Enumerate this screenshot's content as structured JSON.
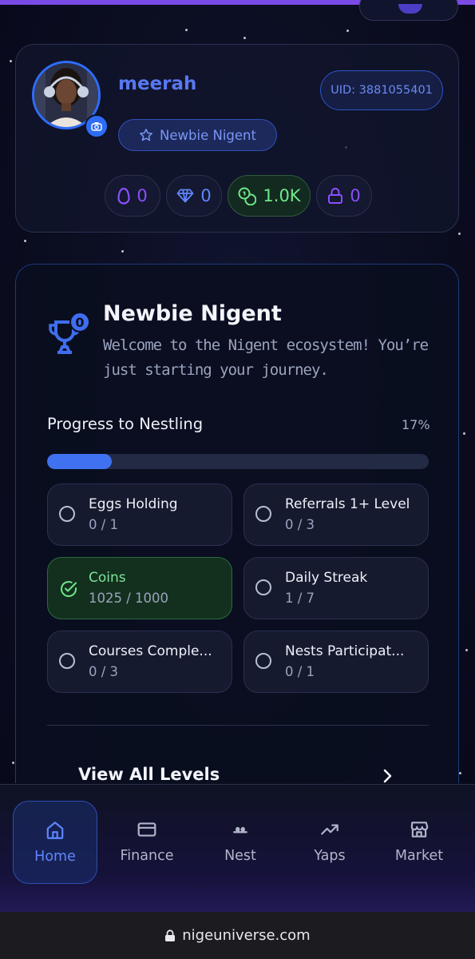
{
  "profile": {
    "username": "meerah",
    "uid": "UID: 3881055401",
    "badge": "Newbie Nigent",
    "stats": [
      {
        "icon": "egg-icon",
        "value": "0",
        "color": "#8a4fff"
      },
      {
        "icon": "diamond-icon",
        "value": "0",
        "color": "#5f86ff"
      },
      {
        "icon": "coins-icon",
        "value": "1.0K",
        "color": "#6fe88a"
      },
      {
        "icon": "lock-icon",
        "value": "0",
        "color": "#8a4fff"
      }
    ]
  },
  "level": {
    "trophy_badge": "0",
    "title": "Newbie Nigent",
    "description": "Welcome to the Nigent ecosystem! You’re just starting your journey.",
    "progress_label": "Progress to Nestling",
    "progress_percent": "17%",
    "progress_value": 0.17,
    "requirements": [
      {
        "name": "Eggs Holding",
        "value": "0 / 1",
        "done": false
      },
      {
        "name": "Referrals 1+ Level",
        "value": "0 / 3",
        "done": false
      },
      {
        "name": "Coins",
        "value": "1025 / 1000",
        "done": true
      },
      {
        "name": "Daily Streak",
        "value": "1 / 7",
        "done": false
      },
      {
        "name": "Courses Comple...",
        "value": "0 / 3",
        "done": false
      },
      {
        "name": "Nests Participat...",
        "value": "0 / 1",
        "done": false
      }
    ],
    "view_all": "View All Levels"
  },
  "nav": {
    "items": [
      {
        "label": "Home",
        "icon": "home-icon",
        "active": true
      },
      {
        "label": "Finance",
        "icon": "card-icon",
        "active": false
      },
      {
        "label": "Nest",
        "icon": "nest-icon",
        "active": false
      },
      {
        "label": "Yaps",
        "icon": "trend-icon",
        "active": false
      },
      {
        "label": "Market",
        "icon": "store-icon",
        "active": false
      }
    ]
  },
  "browser": {
    "url": "nigeuniverse.com"
  },
  "colors": {
    "accent": "#4071f0",
    "success": "#6fe88a",
    "background": "#0b0d20"
  }
}
